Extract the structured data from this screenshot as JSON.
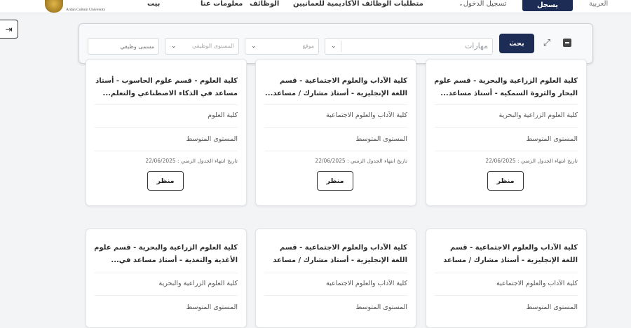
{
  "navbar": {
    "logo_text_line1": "Ardan Cultum University",
    "home": "بيت",
    "about": "معلومات عنا",
    "jobs": "الوظائف",
    "requirements": "متطلبات الوظائف الأكاديمية للعمانيين",
    "login": "تسجيل الدخول",
    "signup": "يسجل",
    "language": "العربية"
  },
  "side_toggle": {
    "icon": "arrow-right-icon"
  },
  "filters": {
    "job_title_placeholder": "مسمى وظيفي",
    "job_level_placeholder": "المستوى الوظيفي",
    "location_placeholder": "موقع",
    "skills_placeholder": "مهارات",
    "search_label": "بحث"
  },
  "cards": [
    {
      "title_line1": "كلية العلوم الزراعية والبحرية - قسم علوم",
      "title_line2": "البحار والثروة السمكية - أستاذ مساعد...",
      "faculty": "كلية العلوم الزراعية والبحرية",
      "level": "المستوى المتوسط",
      "date": "تاريخ انتهاء الجدول الزمني : 22/06/2025",
      "view": "منظر"
    },
    {
      "title_line1": "كلية الآداب والعلوم الاجتماعية - قسم",
      "title_line2": "اللغة الإنجليزية - أستاذ مشارك / مساعد...",
      "faculty": "كلية الآداب والعلوم الاجتماعية",
      "level": "المستوى المتوسط",
      "date": "تاريخ انتهاء الجدول الزمني : 22/06/2025",
      "view": "منظر"
    },
    {
      "title_line1": "كلية العلوم - قسم علوم الحاسوب - أستاذ",
      "title_line2": "مساعد في الذكاء الاصطناعي والتعلم...",
      "faculty": "كلية العلوم",
      "level": "المستوى المتوسط",
      "date": "تاريخ انتهاء الجدول الزمني : 22/06/2025",
      "view": "منظر"
    },
    {
      "title_line1": "كلية الآداب والعلوم الاجتماعية - قسم",
      "title_line2": "اللغة الإنجليزية - أستاذ مشارك / مساعد",
      "faculty": "كلية الآداب والعلوم الاجتماعية",
      "level": "المستوى المتوسط"
    },
    {
      "title_line1": "كلية الآداب والعلوم الاجتماعية - قسم",
      "title_line2": "اللغة الإنجليزية - أستاذ مشارك / مساعد",
      "faculty": "كلية الآداب والعلوم الاجتماعية",
      "level": "المستوى المتوسط"
    },
    {
      "title_line1": "كلية العلوم الزراعية والبحرية - قسم علوم",
      "title_line2": "الأغذية والتغذية - أستاذ مساعد في...",
      "faculty": "كلية العلوم الزراعية والبحرية",
      "level": "المستوى المتوسط"
    }
  ],
  "colors": {
    "primary": "#1d2c55",
    "background": "#f3f4f6"
  }
}
